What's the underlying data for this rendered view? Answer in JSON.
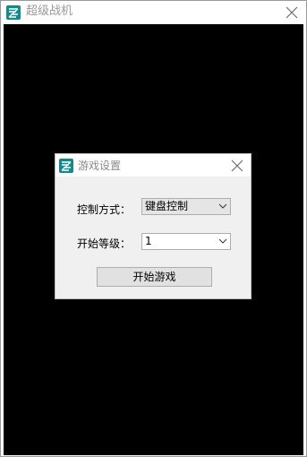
{
  "main_window": {
    "title": "超级战机",
    "icon": "app-logo-icon",
    "close_icon": "close-icon"
  },
  "dialog": {
    "title": "游戏设置",
    "icon": "app-logo-icon",
    "close_icon": "close-icon",
    "control_label": "控制方式：",
    "control_value": "键盘控制",
    "level_label": "开始等级：",
    "level_value": "1",
    "start_button_label": "开始游戏"
  },
  "colors": {
    "canvas": "#000000",
    "icon_accent": "#138a8a",
    "dialog_background": "#f0f0f0"
  }
}
